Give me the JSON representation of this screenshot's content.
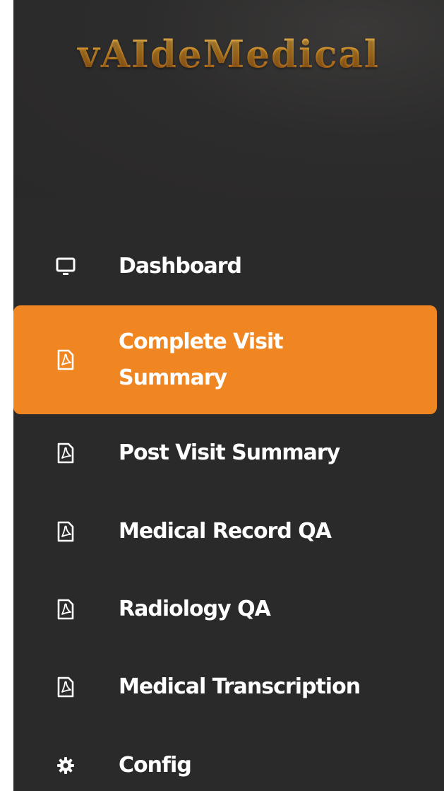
{
  "app": {
    "logo_text": "vAIdeMedical"
  },
  "colors": {
    "sidebar_bg": "#2b2a2a",
    "active_bg": "#f08621",
    "text": "#ffffff",
    "logo_gold": "#e39a2b"
  },
  "sidebar": {
    "items": [
      {
        "label": "Dashboard",
        "icon": "monitor-icon",
        "active": false
      },
      {
        "label": "Complete Visit Summary",
        "icon": "pdf-file-icon",
        "active": true
      },
      {
        "label": "Post Visit Summary",
        "icon": "pdf-file-icon",
        "active": false
      },
      {
        "label": "Medical Record QA",
        "icon": "pdf-file-icon",
        "active": false
      },
      {
        "label": "Radiology QA",
        "icon": "pdf-file-icon",
        "active": false
      },
      {
        "label": "Medical Transcription",
        "icon": "pdf-file-icon",
        "active": false
      },
      {
        "label": "Config",
        "icon": "gear-icon",
        "active": false
      }
    ]
  }
}
